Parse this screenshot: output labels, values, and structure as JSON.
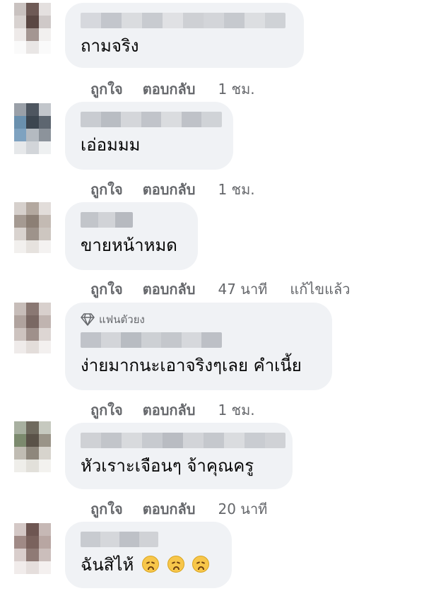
{
  "actions": {
    "like": "ถูกใจ",
    "reply": "ตอบกลับ"
  },
  "comments": [
    {
      "text": "ถามจริง",
      "time": "1 ชม.",
      "edited": ""
    },
    {
      "text": "เอ่อมมม",
      "time": "1 ชม.",
      "edited": ""
    },
    {
      "text": "ขายหน้าหมด",
      "time": "47 นาที",
      "edited": "แก้ไขแล้ว"
    },
    {
      "badge": "แฟนตัวยง",
      "text": "ง่ายมากนะเอาจริงๆเลย คำเนี้ย",
      "time": "1 ชม.",
      "edited": ""
    },
    {
      "text": "หัวเราะเจือนๆ จ้าคุณครู",
      "time": "20 นาที",
      "edited": ""
    },
    {
      "text": "ฉันสิไห้",
      "time": "",
      "edited": "",
      "emojis": [
        "weary-face-icon",
        "weary-face-icon",
        "weary-face-icon"
      ]
    }
  ],
  "colors": {
    "bubble": "#f0f2f5",
    "meta_text": "#65676b",
    "text": "#050505"
  }
}
